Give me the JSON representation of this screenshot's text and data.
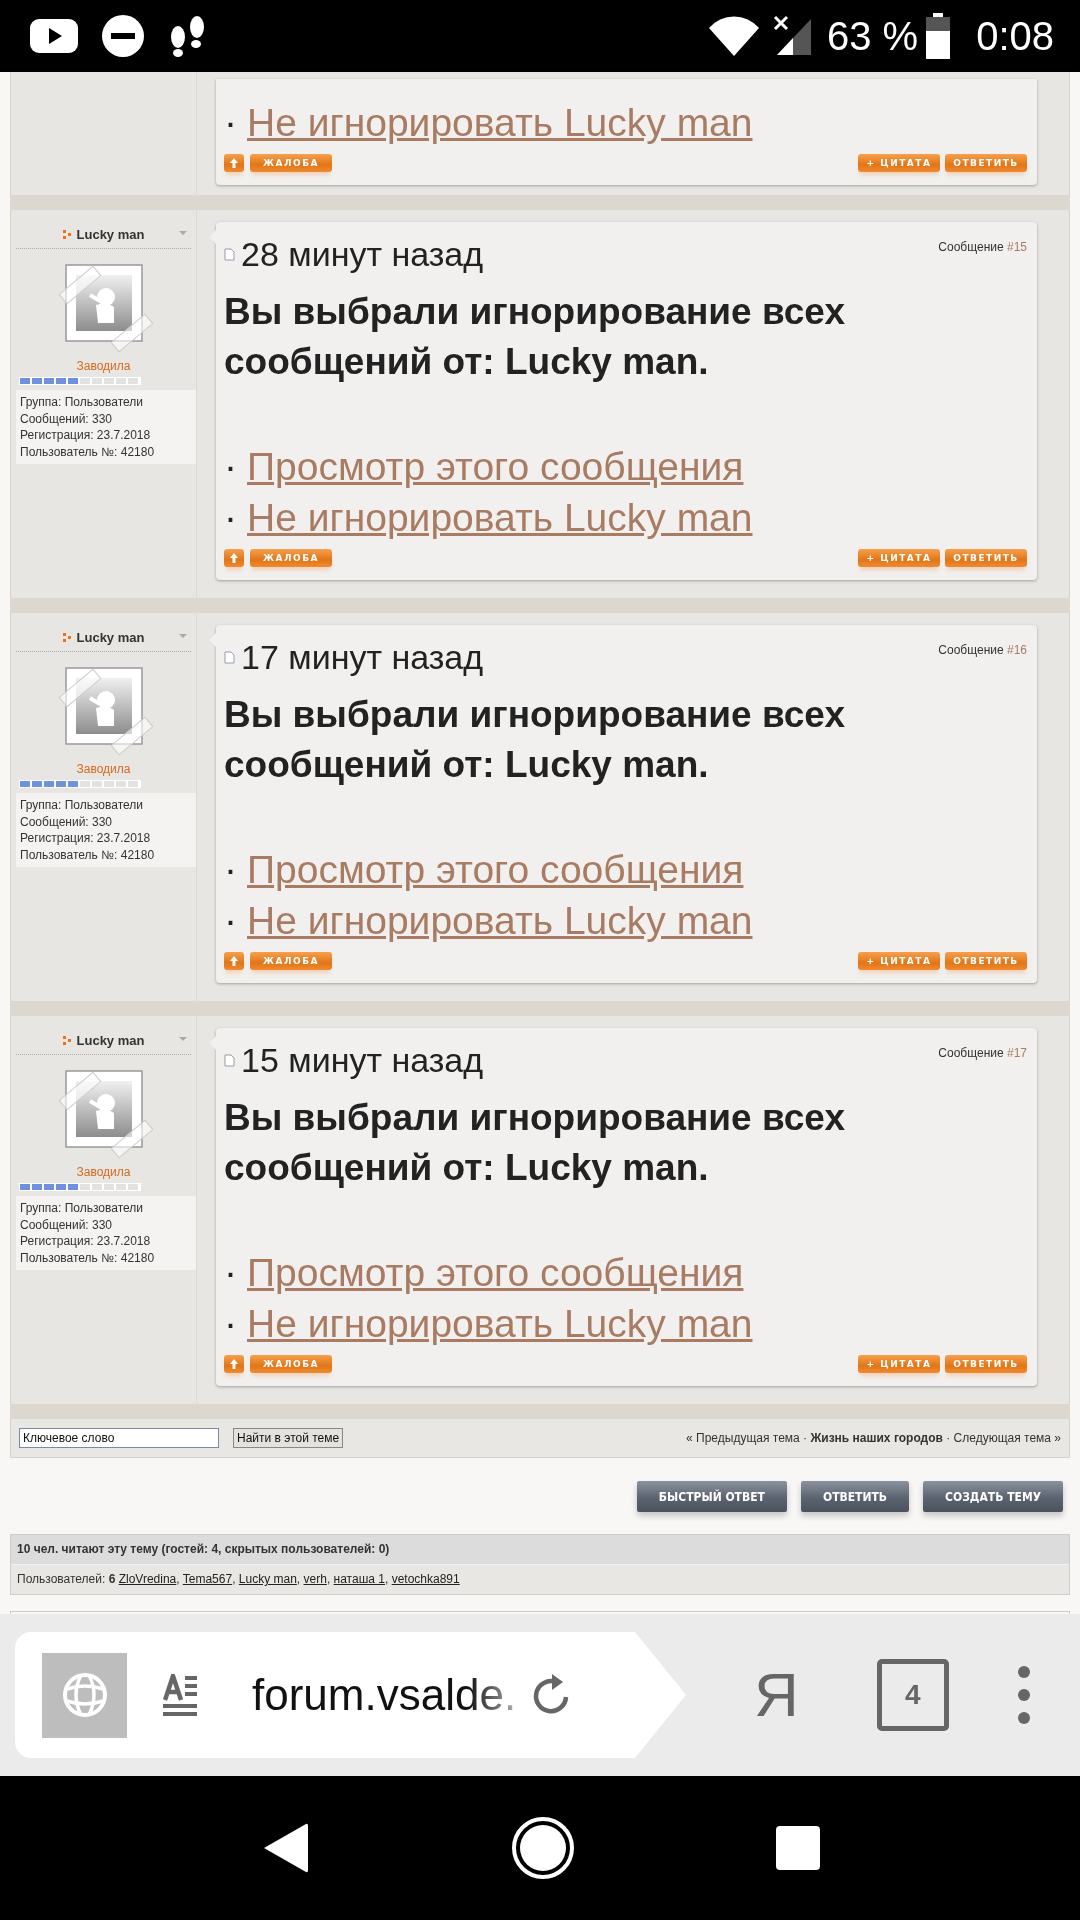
{
  "status_bar": {
    "battery": "63 %",
    "time": "0:08"
  },
  "partial_post": {
    "links": [
      {
        "bullet": "·",
        "text": "Не игнорировать Lucky man"
      }
    ],
    "buttons": {
      "report": "ЖАЛОБА",
      "quote": "+ ЦИТАТА",
      "reply": "ОТВЕТИТЬ"
    }
  },
  "posts": [
    {
      "author": "Lucky man",
      "rank": "Заводила",
      "level": 0.5,
      "info": [
        "Группа: Пользователи",
        "Сообщений: 330",
        "Регистрация: 23.7.2018",
        "Пользователь №: 42180"
      ],
      "time": "28 минут назад",
      "message_label": "Сообщение",
      "message_number": "#15",
      "notice": "Вы выбрали игнорирование всех сообщений от: Lucky man.",
      "links": [
        {
          "bullet": "·",
          "text": "Просмотр этого сообщения"
        },
        {
          "bullet": "·",
          "text": "Не игнорировать Lucky man"
        }
      ],
      "buttons": {
        "report": "ЖАЛОБА",
        "quote": "+ ЦИТАТА",
        "reply": "ОТВЕТИТЬ"
      }
    },
    {
      "author": "Lucky man",
      "rank": "Заводила",
      "level": 0.5,
      "info": [
        "Группа: Пользователи",
        "Сообщений: 330",
        "Регистрация: 23.7.2018",
        "Пользователь №: 42180"
      ],
      "time": "17 минут назад",
      "message_label": "Сообщение",
      "message_number": "#16",
      "notice": "Вы выбрали игнорирование всех сообщений от: Lucky man.",
      "links": [
        {
          "bullet": "·",
          "text": "Просмотр этого сообщения"
        },
        {
          "bullet": "·",
          "text": "Не игнорировать Lucky man"
        }
      ],
      "buttons": {
        "report": "ЖАЛОБА",
        "quote": "+ ЦИТАТА",
        "reply": "ОТВЕТИТЬ"
      }
    },
    {
      "author": "Lucky man",
      "rank": "Заводила",
      "level": 0.5,
      "info": [
        "Группа: Пользователи",
        "Сообщений: 330",
        "Регистрация: 23.7.2018",
        "Пользователь №: 42180"
      ],
      "time": "15 минут назад",
      "message_label": "Сообщение",
      "message_number": "#17",
      "notice": "Вы выбрали игнорирование всех сообщений от: Lucky man.",
      "links": [
        {
          "bullet": "·",
          "text": "Просмотр этого сообщения"
        },
        {
          "bullet": "·",
          "text": "Не игнорировать Lucky man"
        }
      ],
      "buttons": {
        "report": "ЖАЛОБА",
        "quote": "+ ЦИТАТА",
        "reply": "ОТВЕТИТЬ"
      }
    }
  ],
  "search": {
    "value": "Ключевое слово",
    "button": "Найти в этой теме"
  },
  "topic_nav": [
    {
      "kind": "link",
      "text": "« Предыдущая тема"
    },
    {
      "kind": "separator",
      "text": "·"
    },
    {
      "kind": "current",
      "text": "Жизнь наших городов"
    },
    {
      "kind": "separator",
      "text": "·"
    },
    {
      "kind": "link",
      "text": "Следующая тема »"
    }
  ],
  "actions": [
    "БЫСТРЫЙ ОТВЕТ",
    "ОТВЕТИТЬ",
    "СОЗДАТЬ ТЕМУ"
  ],
  "online": {
    "title": "10 чел. читают эту тему (гостей: 4, скрытых пользователей: 0)",
    "users_label": "Пользователей:",
    "users_count": "6",
    "users": [
      {
        "name": "ZloVredina",
        "separator": ","
      },
      {
        "name": "Tema567",
        "separator": ","
      },
      {
        "name": "Lucky man",
        "separator": ","
      },
      {
        "name": "verh",
        "separator": ","
      },
      {
        "name": "наташа 1",
        "separator": ","
      },
      {
        "name": "vetochka891"
      }
    ]
  },
  "browser": {
    "url": "forum.vsalde.",
    "search_logo": "Я",
    "tabs_count": "4"
  }
}
